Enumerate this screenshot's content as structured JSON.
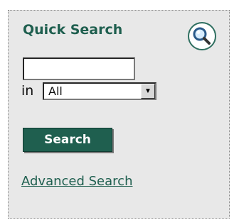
{
  "quick_search": {
    "title": "Quick Search",
    "query": "",
    "in_label": "in",
    "scope_selected": "All",
    "search_button_label": "Search",
    "advanced_link_label": "Advanced Search",
    "magnifier_icon": "magnifier-icon"
  },
  "colors": {
    "accent": "#1f5f4f",
    "panel_bg": "#e8e8e8"
  }
}
